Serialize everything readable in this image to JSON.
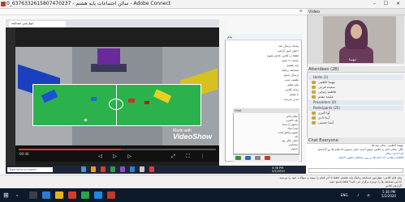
{
  "window": {
    "title": "0_6376332615807470237 - سالن اجتماعات پایه هشتم - Adobe Connect",
    "controls": "–  ☐  ✕"
  },
  "share_pod": {
    "tab_title": "چهارمین مسابقه",
    "label": "Share"
  },
  "video": {
    "watermark_top": "Made with",
    "watermark_brand": "VideoShow",
    "time": "00:40",
    "progress": 0.52,
    "play_icon": "play-icon"
  },
  "popup": {
    "title": "پیام",
    "lines": [
      "پیامک ارسال شد",
      "دانش آموز گرامی",
      "لطفا در کلاس حاضر شوید",
      "ساعت ۸ صبح",
      "پایه هشتم",
      "مسابقه رباتیک",
      "ارسال پاسخ",
      "تکلیف جدید",
      "پیام معلم",
      "زمان کلاس",
      "با تشکر",
      "مدیر مدرسه"
    ],
    "chat_title": "Chat",
    "chat_lines": [
      "سلام خانم",
      "بله حاضرم",
      "ممنون از شما",
      "صدا نمیاد",
      "تصویر واضح است",
      "بله",
      "خیلی عالی بود",
      "متشکرم",
      "ممنون"
    ]
  },
  "inner_taskbar": {
    "search_placeholder": "Type here to search",
    "time": "5:36 PM",
    "date": "5/2/2020"
  },
  "video_pod": {
    "title": "Video",
    "presenter_name": "مهسا"
  },
  "attendees": {
    "title": "Attendees",
    "count": "(28)",
    "groups": [
      {
        "label": "Hosts (3)",
        "items": [
          "مهسا کاظمی",
          "سعیده فرجی",
          "فاطمه رضایی",
          "ملیحه مقدم"
        ]
      },
      {
        "label": "Presenters (0)",
        "items": []
      },
      {
        "label": "Participants (25)",
        "items": [
          "آوا اکبری",
          "آیدا دادی",
          "آیسا حسینی"
        ]
      }
    ]
  },
  "chat": {
    "title": "Chat",
    "scope": "Everyone",
    "messages": [
      {
        "text": "مهسا کاظمی: سلام بچه ها",
        "color": "#333333"
      },
      {
        "text": "نگار: سلام خانم به کلاس خوش آمدید خیلی ممنون که فیلم ها رو گذاشتید",
        "color": "#333333"
      },
      {
        "text": "آیدا دادی: سلام",
        "color": "#1b4fa0"
      },
      {
        "text": "فاطمه رضایی: آیا خانم ها در روز مسابقه حضور داشتند",
        "color": "#1b4fa0"
      }
    ]
  },
  "status_bar": {
    "lines": [
      "پیام های کلاس: چهارمین مسابقه رباتیک پایه هشتم، لطفا تا آخر فیلم را ببینید و سوالات خود را بپرسید",
      "آیا این مسابقه ها را دوباره برگزار می کنید؟ لطفا پاسخ دهید",
      "گزارش کلاس"
    ]
  },
  "taskbar": {
    "start_glyph": "⊞",
    "search_icon": "search-icon",
    "time": "5:36 PM",
    "date": "5/2/2020",
    "tray_lang": "ENG"
  },
  "colors": {
    "field": "#2bb24c",
    "stands_left": "#1a3fbf",
    "stands_right": "#d8c11e",
    "taskbar": "#0c1a2c",
    "seek_fill": "#e53935"
  }
}
